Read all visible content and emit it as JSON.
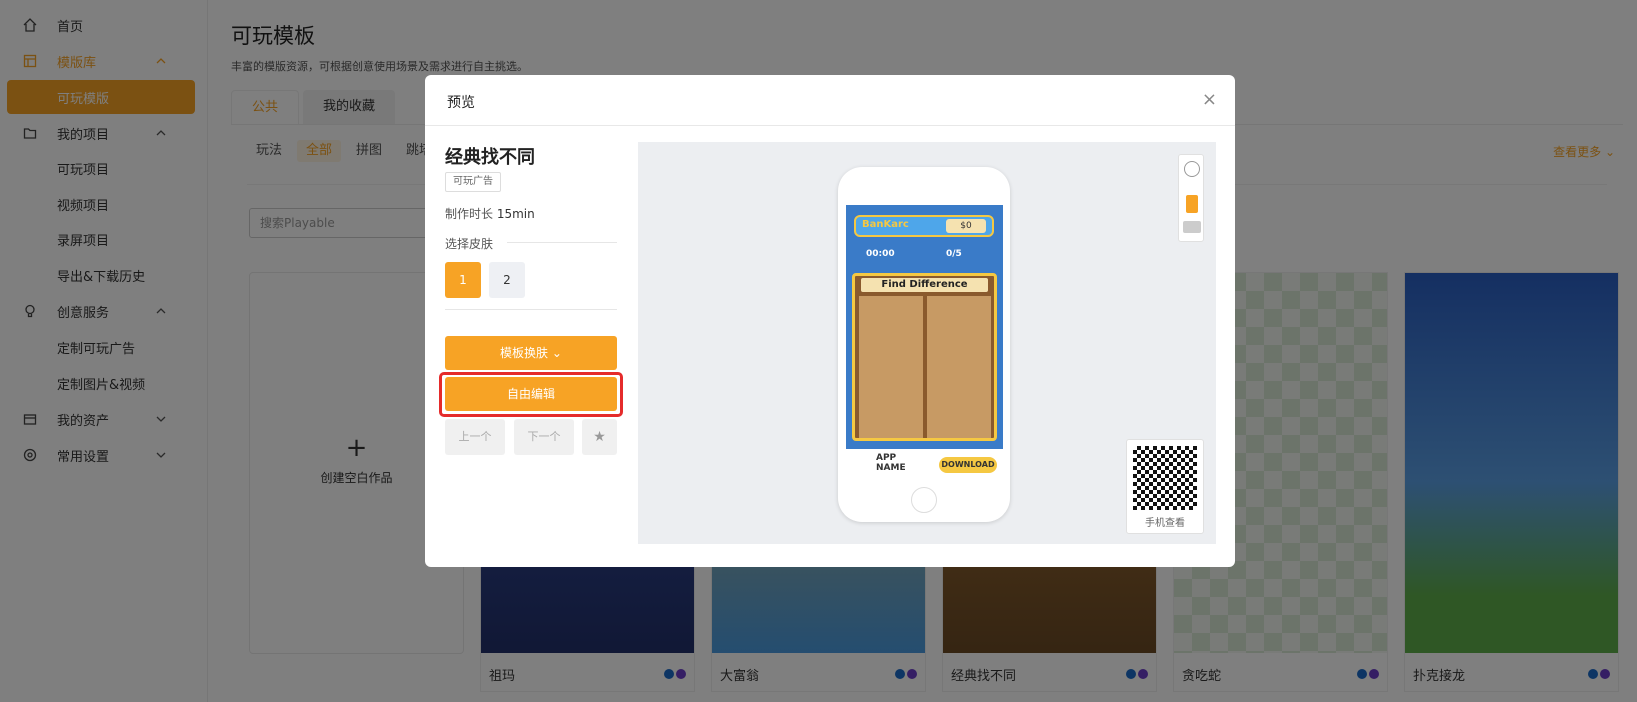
{
  "sidebar": {
    "items": [
      {
        "label": "首页",
        "icon": "home-icon"
      },
      {
        "label": "模版库",
        "icon": "template-icon"
      },
      {
        "label": "可玩模版"
      },
      {
        "label": "我的项目",
        "icon": "folder-icon"
      },
      {
        "label": "可玩项目"
      },
      {
        "label": "视频项目"
      },
      {
        "label": "录屏项目"
      },
      {
        "label": "导出&下载历史"
      },
      {
        "label": "创意服务",
        "icon": "bulb-icon"
      },
      {
        "label": "定制可玩广告"
      },
      {
        "label": "定制图片&视频"
      },
      {
        "label": "我的资产",
        "icon": "box-icon"
      },
      {
        "label": "常用设置",
        "icon": "gear-icon"
      }
    ]
  },
  "page": {
    "title": "可玩模板",
    "subtitle": "丰富的模版资源，可根据创意使用场景及需求进行自主挑选。",
    "tabs": [
      "公共",
      "我的收藏"
    ],
    "filters": [
      "玩法",
      "全部",
      "拼图",
      "跳塔"
    ],
    "more": "查看更多",
    "search_placeholder": "搜索Playable",
    "create_label": "创建空白作品",
    "cards": [
      {
        "name": "祖玛"
      },
      {
        "name": "大富翁"
      },
      {
        "name": "经典找不同"
      },
      {
        "name": "贪吃蛇"
      },
      {
        "name": "扑克接龙"
      }
    ]
  },
  "modal": {
    "title": "预览",
    "close": "×",
    "template_name": "经典找不同",
    "tag": "可玩广告",
    "duration_label": "制作时长",
    "duration_value": "15min",
    "skin_label": "选择皮肤",
    "skins": [
      "1",
      "2"
    ],
    "skin_button": "模板换肤",
    "edit_button": "自由编辑",
    "prev": "上一个",
    "next": "下一个",
    "qr_label": "手机查看"
  },
  "game": {
    "brand": "BanKarc",
    "money": "$0",
    "timer": "00:00",
    "progress": "0/5",
    "banner": "Find Difference",
    "app_name": "APP NAME",
    "download": "DOWNLOAD"
  },
  "colors": {
    "accent": "#f7a325",
    "highlight": "#e52b2b"
  }
}
